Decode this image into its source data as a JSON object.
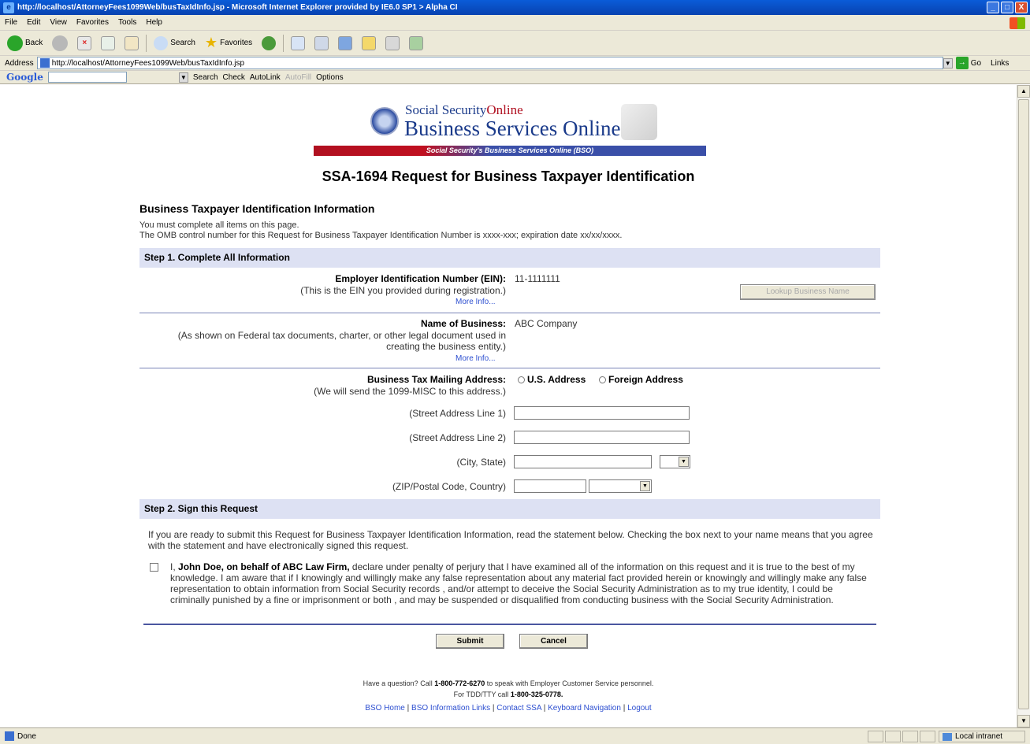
{
  "browser": {
    "title": "http://localhost/AttorneyFees1099Web/busTaxIdInfo.jsp - Microsoft Internet Explorer provided by IE6.0 SP1 > Alpha CI",
    "window_buttons": [
      "_",
      "□",
      "X"
    ],
    "menu": [
      "File",
      "Edit",
      "View",
      "Favorites",
      "Tools",
      "Help"
    ],
    "toolbar": {
      "back": "Back",
      "search": "Search",
      "favorites": "Favorites"
    },
    "address_label": "Address",
    "address": "http://localhost/AttorneyFees1099Web/busTaxIdInfo.jsp",
    "go": "Go",
    "links": "Links",
    "google_bar": {
      "logo": "Google",
      "search": "Search",
      "check": "Check",
      "autolink": "AutoLink",
      "autofill": "AutoFill",
      "options": "Options"
    },
    "status": "Done",
    "zone": "Local intranet"
  },
  "header": {
    "sso_part1": "Social Security",
    "sso_part2": "Online",
    "bso_title": "Business Services Online",
    "bso_bar": "Social Security's Business Services Online (BSO)"
  },
  "page_title": "SSA-1694 Request for Business Taxpayer Identification",
  "section_heading": "Business Taxpayer Identification Information",
  "intro": [
    "You must complete all items on this page.",
    "The OMB control number for this Request for Business Taxpayer Identification Number is xxxx-xxx; expiration date xx/xx/xxxx."
  ],
  "step1": {
    "heading": "Step 1.  Complete All Information",
    "ein_label": "Employer Identification Number (EIN):",
    "ein_note": "(This is the EIN you provided during registration.)",
    "ein_value": "11-1111111",
    "more_info": "More Info...",
    "lookup_button": "Lookup Business Name",
    "name_label": "Name of Business:",
    "name_note": "(As shown on Federal tax documents, charter, or other legal document used in creating the business entity.)",
    "name_value": "ABC Company",
    "address_label": "Business Tax Mailing Address:",
    "address_note": "(We will send the 1099-MISC to this address.)",
    "radio_us": "U.S. Address",
    "radio_foreign": "Foreign Address",
    "street1_label": "(Street Address Line 1)",
    "street2_label": "(Street Address Line 2)",
    "city_label": "(City, State)",
    "zip_label": "(ZIP/Postal Code, Country)"
  },
  "step2": {
    "heading": "Step 2.  Sign this Request",
    "instruction": "If you are ready to submit this Request for Business Taxpayer Identification Information, read the statement below. Checking the box next to your name means that you agree with the statement and have electronically signed this request.",
    "decl_prefix": "I, ",
    "decl_name": "John Doe, on behalf of ABC Law Firm,",
    "decl_text": " declare under penalty of perjury that I have examined all of the information on this request and it is true to the best of my knowledge. I am aware that if I knowingly and willingly make any false representation about any material fact provided herein or knowingly and willingly make any false representation to obtain information from Social Security records , and/or attempt to deceive the Social Security Administration as to my true identity, I could be criminally punished by a fine or imprisonment or both , and may be suspended or disqualified from conducting business with the Social Security Administration."
  },
  "buttons": {
    "submit": "Submit",
    "cancel": "Cancel"
  },
  "footer": {
    "line1_pre": "Have a question? Call ",
    "line1_phone": "1-800-772-6270",
    "line1_post": " to speak with Employer Customer Service personnel.",
    "line2_pre": "For TDD/TTY call ",
    "line2_phone": "1-800-325-0778.",
    "links": [
      "BSO Home",
      "BSO Information Links",
      "Contact SSA",
      "Keyboard Navigation",
      "Logout"
    ]
  },
  "colors": {
    "step_bg": "#dde1f3",
    "link": "#2d4fd0",
    "brand_blue": "#1a3a8a",
    "brand_red": "#b01020"
  }
}
